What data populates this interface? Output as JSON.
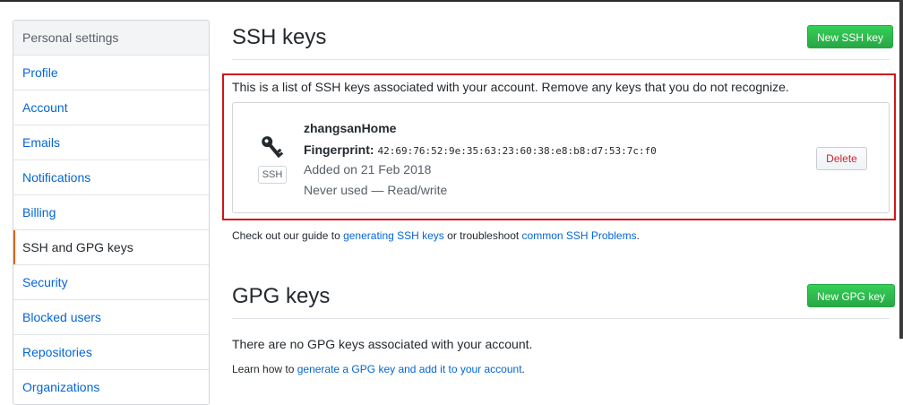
{
  "sidebar": {
    "header": "Personal settings",
    "items": [
      {
        "label": "Profile"
      },
      {
        "label": "Account"
      },
      {
        "label": "Emails"
      },
      {
        "label": "Notifications"
      },
      {
        "label": "Billing"
      },
      {
        "label": "SSH and GPG keys",
        "selected": true
      },
      {
        "label": "Security"
      },
      {
        "label": "Blocked users"
      },
      {
        "label": "Repositories"
      },
      {
        "label": "Organizations"
      }
    ]
  },
  "ssh": {
    "title": "SSH keys",
    "new_button": "New SSH key",
    "intro": "This is a list of SSH keys associated with your account. Remove any keys that you do not recognize.",
    "key": {
      "icon": "key-icon",
      "badge": "SSH",
      "name": "zhangsanHome",
      "fingerprint_label": "Fingerprint:",
      "fingerprint": "42:69:76:52:9e:35:63:23:60:38:e8:b8:d7:53:7c:f0",
      "added": "Added on 21 Feb 2018",
      "usage": "Never used — Read/write",
      "delete_label": "Delete"
    },
    "help": {
      "prefix": "Check out our guide to ",
      "link1": "generating SSH keys",
      "middle": " or troubleshoot ",
      "link2": "common SSH Problems",
      "suffix": "."
    }
  },
  "gpg": {
    "title": "GPG keys",
    "new_button": "New GPG key",
    "empty": "There are no GPG keys associated with your account.",
    "help": {
      "prefix": "Learn how to ",
      "link": "generate a GPG key and add it to your account",
      "suffix": "."
    }
  },
  "colors": {
    "link": "#0366d6",
    "green": "#28a745",
    "danger": "#cb2431",
    "highlight": "#d0161b",
    "selected_bar": "#e36209"
  }
}
